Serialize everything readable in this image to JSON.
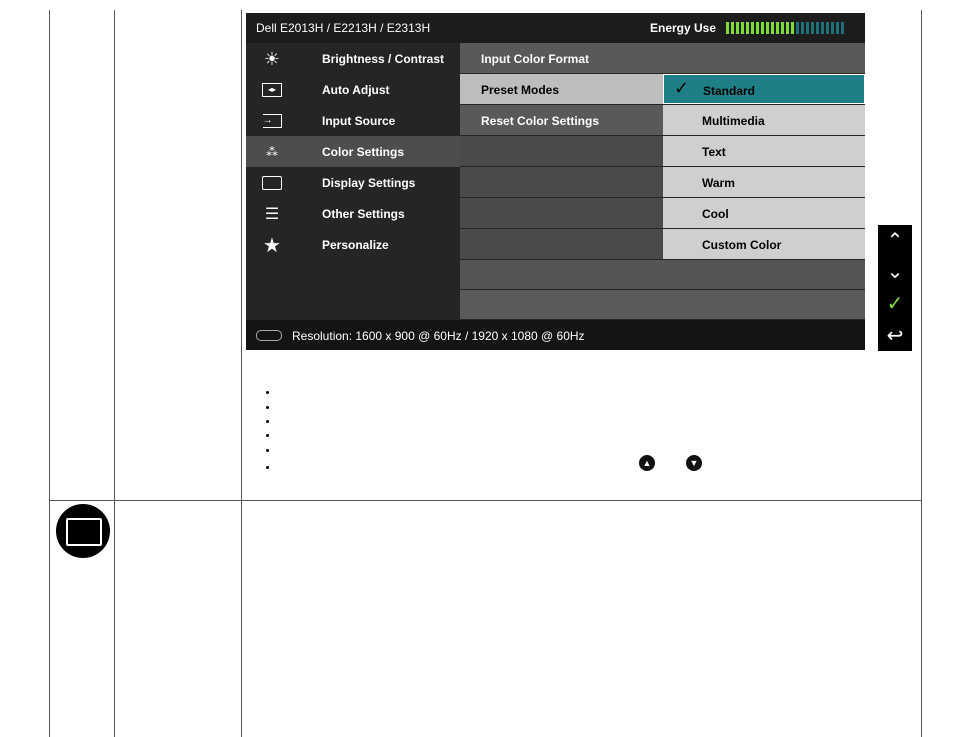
{
  "osd": {
    "title": "Dell E2013H / E2213H / E2313H",
    "energy_label": "Energy Use",
    "energy_level": 0.6,
    "colors": {
      "accent": "#1f7f86",
      "energy_on": "#7ddc3a",
      "energy_off": "#1d6f78"
    },
    "menu": [
      {
        "label": "Brightness / Contrast",
        "icon": "brightness-icon"
      },
      {
        "label": "Auto Adjust",
        "icon": "auto-adjust-icon"
      },
      {
        "label": "Input Source",
        "icon": "input-source-icon"
      },
      {
        "label": "Color Settings",
        "icon": "color-settings-icon"
      },
      {
        "label": "Display Settings",
        "icon": "display-settings-icon"
      },
      {
        "label": "Other Settings",
        "icon": "other-settings-icon"
      },
      {
        "label": "Personalize",
        "icon": "star-icon"
      }
    ],
    "submenu": [
      {
        "label": "Input Color Format"
      },
      {
        "label": "Preset Modes"
      },
      {
        "label": "Reset Color Settings"
      }
    ],
    "options": [
      {
        "label": "Standard"
      },
      {
        "label": "Multimedia"
      },
      {
        "label": "Text"
      },
      {
        "label": "Warm"
      },
      {
        "label": "Cool"
      },
      {
        "label": "Custom Color"
      }
    ],
    "resolution": "Resolution:  1600 x 900 @ 60Hz / 1920 x 1080 @ 60Hz"
  },
  "side_buttons": [
    "up-icon",
    "down-icon",
    "check-icon",
    "back-icon"
  ]
}
